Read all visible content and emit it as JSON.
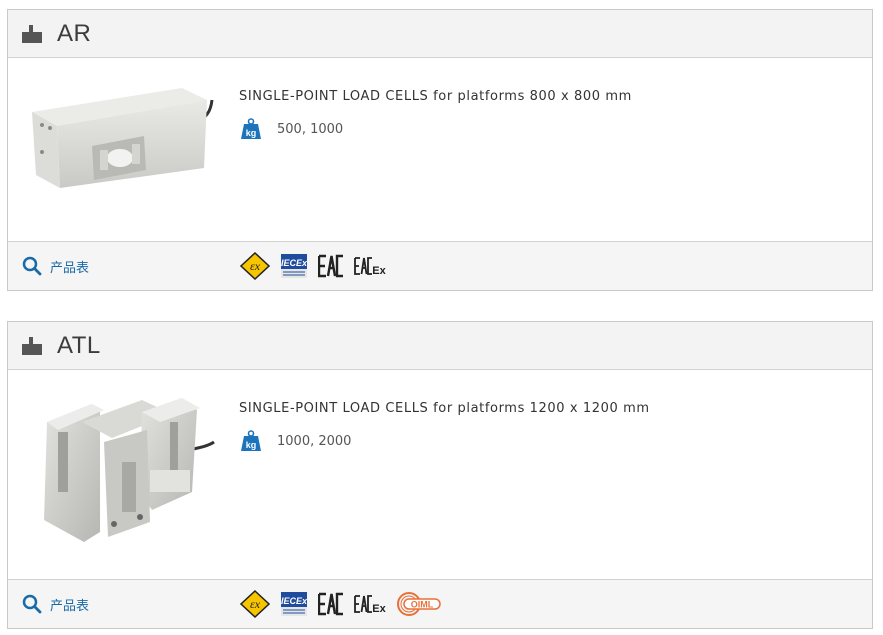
{
  "products": [
    {
      "title": "AR",
      "icon": "load-cell-icon",
      "description_bold": "SINGLE-POINT LOAD CELLS",
      "description_rest": " for platforms 800 x 800 mm",
      "capacity": "500, 1000",
      "datasheet_label": "产品表",
      "certifications": [
        "ATEX",
        "IECEx",
        "EAC",
        "EAC Ex"
      ]
    },
    {
      "title": "ATL",
      "icon": "load-cell-icon",
      "description_bold": "SINGLE-POINT LOAD CELLS",
      "description_rest": " for platforms 1200 x 1200 mm",
      "capacity": "1000, 2000",
      "datasheet_label": "产品表",
      "certifications": [
        "ATEX",
        "IECEx",
        "EAC",
        "EAC Ex",
        "OIML"
      ]
    }
  ],
  "colors": {
    "accent_blue": "#1a6aa8",
    "kg_blue": "#1c75bc",
    "atex_yellow": "#f6c500",
    "oiml_orange": "#e8703a"
  }
}
